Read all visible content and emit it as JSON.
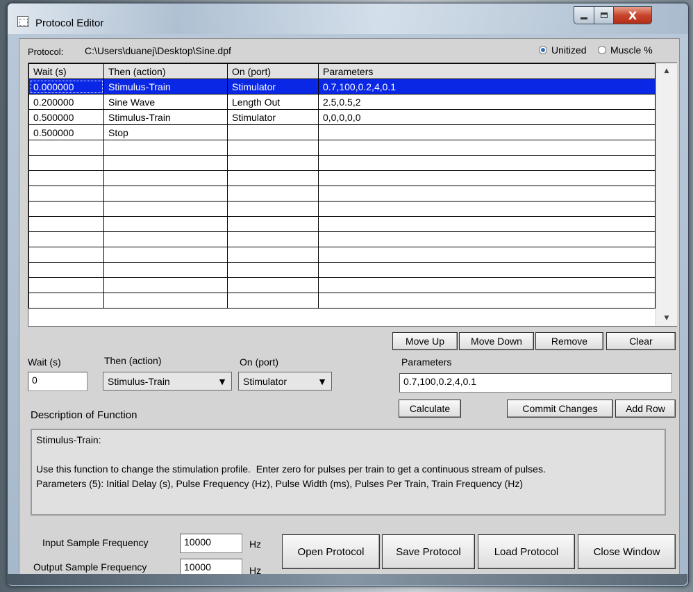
{
  "window": {
    "title": "Protocol Editor",
    "close_glyph": "X"
  },
  "protocol": {
    "label": "Protocol:",
    "path": "C:\\Users\\duanej\\Desktop\\Sine.dpf"
  },
  "mode": {
    "options": [
      "Unitized",
      "Muscle %"
    ],
    "selected": "Unitized"
  },
  "table": {
    "headers": [
      "Wait (s)",
      "Then (action)",
      "On (port)",
      "Parameters"
    ],
    "rows": [
      [
        "0.000000",
        "Stimulus-Train",
        "Stimulator",
        "0.7,100,0.2,4,0.1"
      ],
      [
        "0.200000",
        "Sine Wave",
        "Length Out",
        "2.5,0.5,2"
      ],
      [
        "0.500000",
        "Stimulus-Train",
        "Stimulator",
        "0,0,0,0,0"
      ],
      [
        "0.500000",
        "Stop",
        "",
        ""
      ]
    ],
    "empty_rows": 11,
    "selected_row": 0
  },
  "table_buttons": {
    "move_up": "Move Up",
    "move_down": "Move Down",
    "remove": "Remove",
    "clear": "Clear"
  },
  "editor": {
    "wait_label": "Wait (s)",
    "wait_value": "0",
    "action_label": "Then (action)",
    "action_value": "Stimulus-Train",
    "port_label": "On (port)",
    "port_value": "Stimulator",
    "params_label": "Parameters",
    "params_value": "0.7,100,0.2,4,0.1",
    "calculate": "Calculate",
    "commit": "Commit Changes",
    "add_row": "Add Row"
  },
  "description": {
    "label": "Description of Function",
    "text": "Stimulus-Train:\n\nUse this function to change the stimulation profile.  Enter zero for pulses per train to get a continuous stream of pulses.\nParameters (5): Initial Delay (s), Pulse Frequency (Hz), Pulse Width (ms), Pulses Per Train, Train Frequency (Hz)"
  },
  "sampling": {
    "input_label": "Input Sample Frequency",
    "input_value": "10000",
    "output_label": "Output Sample Frequency",
    "output_value": "10000",
    "unit": "Hz"
  },
  "bottom_buttons": {
    "open": "Open Protocol",
    "save": "Save Protocol",
    "load": "Load Protocol",
    "close": "Close Window"
  },
  "colors": {
    "selection": "#0a27e6",
    "radio_selected": "#2a6fb8",
    "close_button": "#c8452d"
  }
}
